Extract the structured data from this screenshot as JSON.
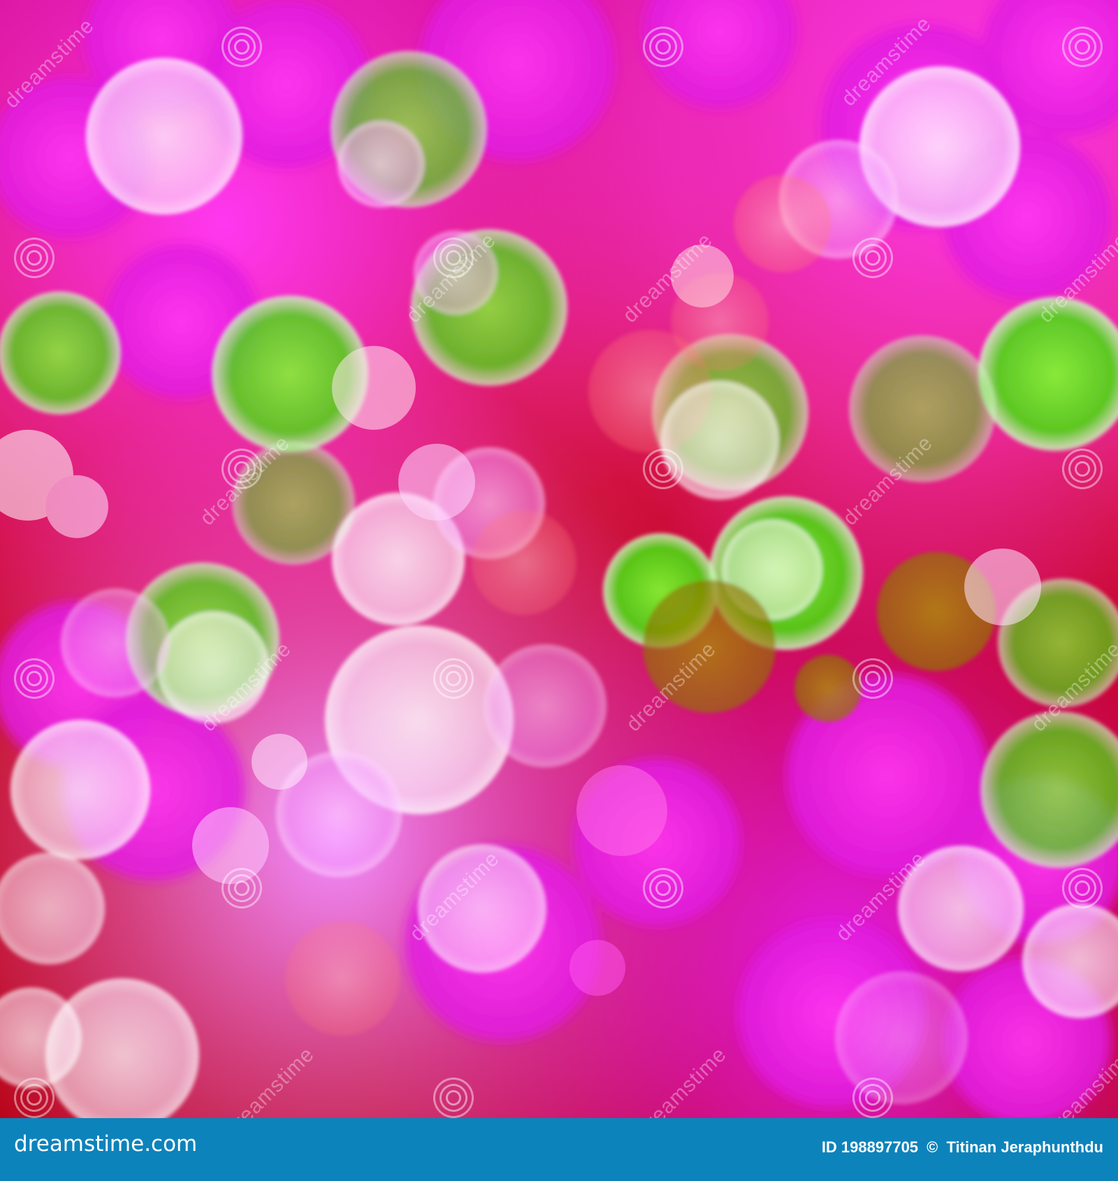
{
  "footer": {
    "logo": "dreamstime.com",
    "credit_id": "ID 198897705",
    "credit_symbol": "©",
    "credit_author": "Titinan Jeraphunthdu"
  },
  "watermark": {
    "text": "dreamstime"
  },
  "colors": {
    "footer": "#0d83bb",
    "red": "#c3000f",
    "magenta": "#ff2ff0",
    "pink": "#f7b4ff",
    "green": "#59f11a",
    "white": "#ffffff"
  }
}
